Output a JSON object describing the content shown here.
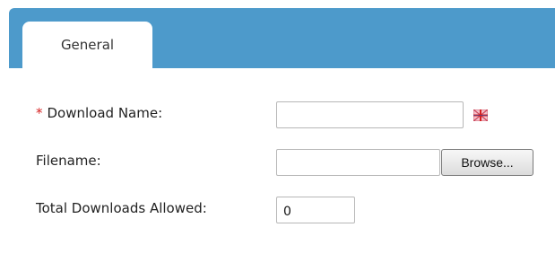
{
  "tabs": [
    {
      "label": "General"
    }
  ],
  "form": {
    "download_name": {
      "required_marker": "*",
      "label": "Download Name:",
      "value": "",
      "flag_icon": "language-flag-icon"
    },
    "filename": {
      "label": "Filename:",
      "value": "",
      "button_label": "Browse..."
    },
    "total_downloads": {
      "label": "Total Downloads Allowed:",
      "value": "0"
    }
  },
  "colors": {
    "tab_bar": "#4d9acb",
    "required_star": "#d62020"
  }
}
